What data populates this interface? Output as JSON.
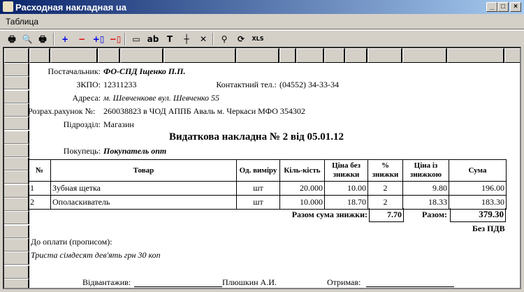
{
  "window": {
    "title": "Расходная накладная  ua",
    "buttons": [
      "_",
      "□",
      "×"
    ]
  },
  "menu": [
    "Таблица"
  ],
  "toolbar": [
    {
      "icon": "print-icon",
      "glyph": "🖶"
    },
    {
      "icon": "print-preview-icon",
      "glyph": "🔍"
    },
    {
      "icon": "print-settings-icon",
      "glyph": "🖶"
    },
    {
      "icon": "insert-row-icon",
      "glyph": "+"
    },
    {
      "icon": "delete-row-icon",
      "glyph": "−"
    },
    {
      "icon": "insert-column-icon",
      "glyph": "+▯"
    },
    {
      "icon": "delete-column-icon",
      "glyph": "−▯"
    },
    {
      "icon": "merge-cells-icon",
      "glyph": "▭"
    },
    {
      "icon": "text-format-icon",
      "glyph": "ab"
    },
    {
      "icon": "text-icon",
      "glyph": "T"
    },
    {
      "icon": "cell-borders-icon",
      "glyph": "┼"
    },
    {
      "icon": "clear-icon",
      "glyph": "✕"
    },
    {
      "icon": "find-icon",
      "glyph": "⚲"
    },
    {
      "icon": "refresh-icon",
      "glyph": "⟳"
    },
    {
      "icon": "export-xls-icon",
      "glyph": "XLS"
    }
  ],
  "doc": {
    "supplier_label": "Постачальник:",
    "supplier": "ФО-СПД Іщенко П.П.",
    "zkpo_label": "ЗКПО:",
    "zkpo": "12311233",
    "phone_label": "Контактний тел.:",
    "phone": "(04552) 34-33-34",
    "address_label": "Адреса:",
    "address": "м. Шевченкове вул. Шевченко 55",
    "account_label": "Розрах.рахунок №:",
    "account": "260038823 в ЧОД АППБ Аваль м. Черкаси МФО 354302",
    "dept_label": "Підрозділ:",
    "dept": "Магазин",
    "title": "Видаткова накладна № 2 від 05.01.12",
    "buyer_label": "Покупець:",
    "buyer": "Покупатель опт",
    "columns": [
      "№",
      "Товар",
      "Од. виміру",
      "Кіль-кість",
      "Ціна без знижки",
      "% знижки",
      "Ціна із знижкою",
      "Сума"
    ],
    "rows": [
      [
        "1",
        "Зубная щетка",
        "шт",
        "20.000",
        "10.00",
        "2",
        "9.80",
        "196.00"
      ],
      [
        "2",
        "Ополаскиватель",
        "шт",
        "10.000",
        "18.70",
        "2",
        "18.33",
        "183.30"
      ]
    ],
    "discount_total_label": "Разом сума знижки:",
    "discount_total": "7.70",
    "total_label": "Разом:",
    "total": "379.30",
    "vat_note": "Без ПДВ",
    "words_label": "До оплати (прописом):",
    "words": "Триста сімдесят дев'ять грн 30 коп",
    "shipped_label": "Відвантажив:",
    "shipped_by": "Плюшкин А.И.",
    "received_label": "Отримав:"
  }
}
